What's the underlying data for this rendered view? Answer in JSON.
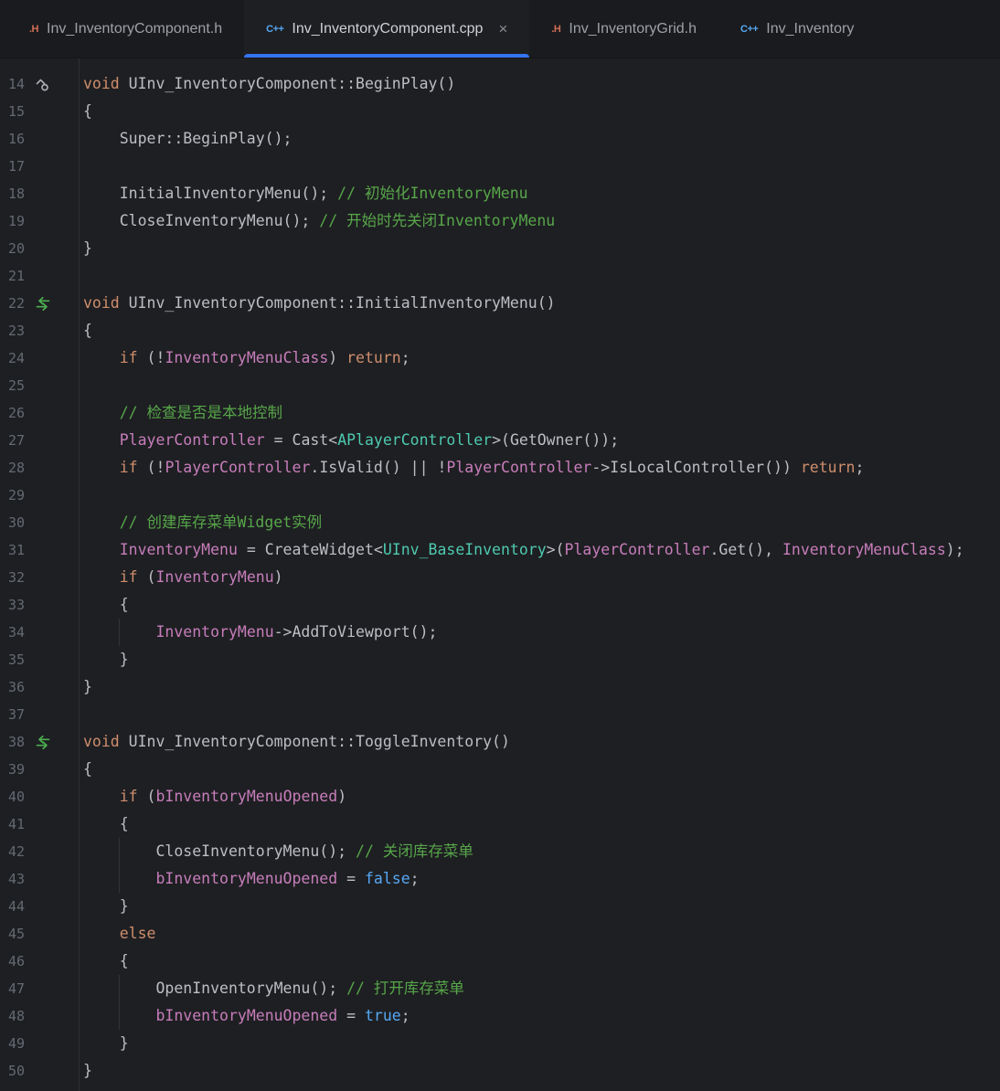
{
  "colors": {
    "accent": "#3574F0",
    "keyword": "#CF8E6D",
    "field": "#C77DBB",
    "comment": "#57A64A",
    "type": "#4EC9B0",
    "boolean": "#56A8F5",
    "plain": "#BCBEC4",
    "line_number": "#646A73",
    "header_icon": "#CF6E56",
    "cpp_icon": "#56A8F5",
    "gutter_icon_gray": "#A8ABB2",
    "gutter_icon_green": "#4CAE4F"
  },
  "tab_bar": {
    "tabs": [
      {
        "icon": "header-file-icon",
        "icon_text": ".H",
        "label": "Inv_InventoryComponent.h",
        "active": false,
        "close": false,
        "close_glyph": "×"
      },
      {
        "icon": "cpp-file-icon",
        "icon_text": "C++",
        "label": "Inv_InventoryComponent.cpp",
        "active": true,
        "close": true,
        "close_glyph": "×"
      },
      {
        "icon": "header-file-icon",
        "icon_text": ".H",
        "label": "Inv_InventoryGrid.h",
        "active": false,
        "close": false,
        "close_glyph": "×"
      },
      {
        "icon": "cpp-file-icon",
        "icon_text": "C++",
        "label": "Inv_Inventory",
        "active": false,
        "close": false,
        "close_glyph": "×"
      }
    ]
  },
  "editor": {
    "lines": [
      {
        "num": "14",
        "icon": "override-marker-icon",
        "tokens": [
          [
            "kw",
            "void"
          ],
          [
            "pl",
            " UInv_InventoryComponent::BeginPlay()"
          ]
        ]
      },
      {
        "num": "15",
        "tokens": [
          [
            "pl",
            "{"
          ]
        ]
      },
      {
        "num": "16",
        "tokens": [
          [
            "pl",
            "    Super::BeginPlay();"
          ]
        ]
      },
      {
        "num": "17",
        "tokens": []
      },
      {
        "num": "18",
        "tokens": [
          [
            "pl",
            "    InitialInventoryMenu(); "
          ],
          [
            "cmt",
            "// 初始化InventoryMenu"
          ]
        ]
      },
      {
        "num": "19",
        "tokens": [
          [
            "pl",
            "    CloseInventoryMenu(); "
          ],
          [
            "cmt",
            "// 开始时先关闭InventoryMenu"
          ]
        ]
      },
      {
        "num": "20",
        "tokens": [
          [
            "pl",
            "}"
          ]
        ]
      },
      {
        "num": "21",
        "tokens": []
      },
      {
        "num": "22",
        "icon": "hot-reload-icon",
        "tokens": [
          [
            "kw",
            "void"
          ],
          [
            "pl",
            " UInv_InventoryComponent::InitialInventoryMenu()"
          ]
        ]
      },
      {
        "num": "23",
        "tokens": [
          [
            "pl",
            "{"
          ]
        ]
      },
      {
        "num": "24",
        "tokens": [
          [
            "pl",
            "    "
          ],
          [
            "kw",
            "if"
          ],
          [
            "pl",
            " (!"
          ],
          [
            "fld",
            "InventoryMenuClass"
          ],
          [
            "pl",
            ") "
          ],
          [
            "kw",
            "return"
          ],
          [
            "pl",
            ";"
          ]
        ]
      },
      {
        "num": "25",
        "tokens": []
      },
      {
        "num": "26",
        "tokens": [
          [
            "pl",
            "    "
          ],
          [
            "cmt",
            "// 检查是否是本地控制"
          ]
        ]
      },
      {
        "num": "27",
        "tokens": [
          [
            "pl",
            "    "
          ],
          [
            "fld",
            "PlayerController"
          ],
          [
            "pl",
            " = Cast<"
          ],
          [
            "typ",
            "APlayerController"
          ],
          [
            "pl",
            ">(GetOwner());"
          ]
        ]
      },
      {
        "num": "28",
        "tokens": [
          [
            "pl",
            "    "
          ],
          [
            "kw",
            "if"
          ],
          [
            "pl",
            " (!"
          ],
          [
            "fld",
            "PlayerController"
          ],
          [
            "pl",
            ".IsValid() || !"
          ],
          [
            "fld",
            "PlayerController"
          ],
          [
            "pl",
            "->IsLocalController()) "
          ],
          [
            "kw",
            "return"
          ],
          [
            "pl",
            ";"
          ]
        ]
      },
      {
        "num": "29",
        "tokens": []
      },
      {
        "num": "30",
        "tokens": [
          [
            "pl",
            "    "
          ],
          [
            "cmt",
            "// 创建库存菜单Widget实例"
          ]
        ]
      },
      {
        "num": "31",
        "tokens": [
          [
            "pl",
            "    "
          ],
          [
            "fld",
            "InventoryMenu"
          ],
          [
            "pl",
            " = CreateWidget<"
          ],
          [
            "typ",
            "UInv_BaseInventory"
          ],
          [
            "pl",
            ">("
          ],
          [
            "fld",
            "PlayerController"
          ],
          [
            "pl",
            ".Get(), "
          ],
          [
            "fld",
            "InventoryMenuClass"
          ],
          [
            "pl",
            ");"
          ]
        ]
      },
      {
        "num": "32",
        "tokens": [
          [
            "pl",
            "    "
          ],
          [
            "kw",
            "if"
          ],
          [
            "pl",
            " ("
          ],
          [
            "fld",
            "InventoryMenu"
          ],
          [
            "pl",
            ")"
          ]
        ]
      },
      {
        "num": "33",
        "tokens": [
          [
            "pl",
            "    {"
          ]
        ]
      },
      {
        "num": "34",
        "guide": true,
        "tokens": [
          [
            "pl",
            "        "
          ],
          [
            "fld",
            "InventoryMenu"
          ],
          [
            "pl",
            "->AddToViewport();"
          ]
        ]
      },
      {
        "num": "35",
        "tokens": [
          [
            "pl",
            "    }"
          ]
        ]
      },
      {
        "num": "36",
        "tokens": [
          [
            "pl",
            "}"
          ]
        ]
      },
      {
        "num": "37",
        "tokens": []
      },
      {
        "num": "38",
        "icon": "hot-reload-icon",
        "tokens": [
          [
            "kw",
            "void"
          ],
          [
            "pl",
            " UInv_InventoryComponent::ToggleInventory()"
          ]
        ]
      },
      {
        "num": "39",
        "tokens": [
          [
            "pl",
            "{"
          ]
        ]
      },
      {
        "num": "40",
        "tokens": [
          [
            "pl",
            "    "
          ],
          [
            "kw",
            "if"
          ],
          [
            "pl",
            " ("
          ],
          [
            "fld",
            "bInventoryMenuOpened"
          ],
          [
            "pl",
            ")"
          ]
        ]
      },
      {
        "num": "41",
        "tokens": [
          [
            "pl",
            "    {"
          ]
        ]
      },
      {
        "num": "42",
        "guide": true,
        "tokens": [
          [
            "pl",
            "        CloseInventoryMenu(); "
          ],
          [
            "cmt",
            "// 关闭库存菜单"
          ]
        ]
      },
      {
        "num": "43",
        "guide": true,
        "tokens": [
          [
            "pl",
            "        "
          ],
          [
            "fld",
            "bInventoryMenuOpened"
          ],
          [
            "pl",
            " = "
          ],
          [
            "bool",
            "false"
          ],
          [
            "pl",
            ";"
          ]
        ]
      },
      {
        "num": "44",
        "tokens": [
          [
            "pl",
            "    }"
          ]
        ]
      },
      {
        "num": "45",
        "tokens": [
          [
            "pl",
            "    "
          ],
          [
            "kw",
            "else"
          ]
        ]
      },
      {
        "num": "46",
        "tokens": [
          [
            "pl",
            "    {"
          ]
        ]
      },
      {
        "num": "47",
        "guide": true,
        "tokens": [
          [
            "pl",
            "        OpenInventoryMenu(); "
          ],
          [
            "cmt",
            "// 打开库存菜单"
          ]
        ]
      },
      {
        "num": "48",
        "guide": true,
        "tokens": [
          [
            "pl",
            "        "
          ],
          [
            "fld",
            "bInventoryMenuOpened"
          ],
          [
            "pl",
            " = "
          ],
          [
            "bool",
            "true"
          ],
          [
            "pl",
            ";"
          ]
        ]
      },
      {
        "num": "49",
        "tokens": [
          [
            "pl",
            "    }"
          ]
        ]
      },
      {
        "num": "50",
        "tokens": [
          [
            "pl",
            "}"
          ]
        ]
      }
    ]
  }
}
